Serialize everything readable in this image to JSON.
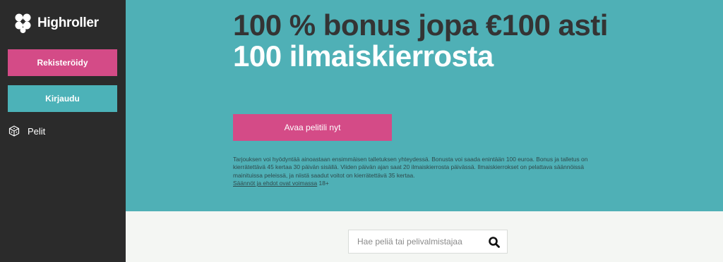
{
  "sidebar": {
    "logo_text": "Highroller",
    "register_label": "Rekisteröidy",
    "login_label": "Kirjaudu",
    "nav_games_label": "Pelit",
    "nav_games_icon": "dice-icon",
    "logo_icon": "bubbles-logo-icon"
  },
  "hero": {
    "headline_dark": "100 % bonus jopa €100 asti",
    "headline_light": "100 ilmaiskierrosta",
    "cta_label": "Avaa pelitili nyt",
    "terms_text": "Tarjouksen voi hyödyntää ainoastaan ensimmäisen talletuksen yhteydessä. Bonusta voi saada enintään 100 euroa. Bonus ja talletus on kierrätettävä 45 kertaa 30 päivän sisällä. Viiden päivän ajan saat 20 ilmaiskierrosta päivässä. Ilmaiskierrokset on pelattava säännöissä mainituissa peleissä, ja niistä saadut voitot on kierrätettävä 35 kertaa.",
    "terms_link": "Säännöt ja ehdot ovat voimassa",
    "age_note": "18+"
  },
  "search": {
    "placeholder": "Hae peliä tai pelivalmistajaa",
    "icon": "search-icon"
  },
  "colors": {
    "sidebar_bg": "#2b2b2b",
    "hero_bg": "#4fb0b6",
    "accent_pink": "#d44b87",
    "accent_teal": "#4cb2b8",
    "page_bg": "#f4f6f3"
  }
}
